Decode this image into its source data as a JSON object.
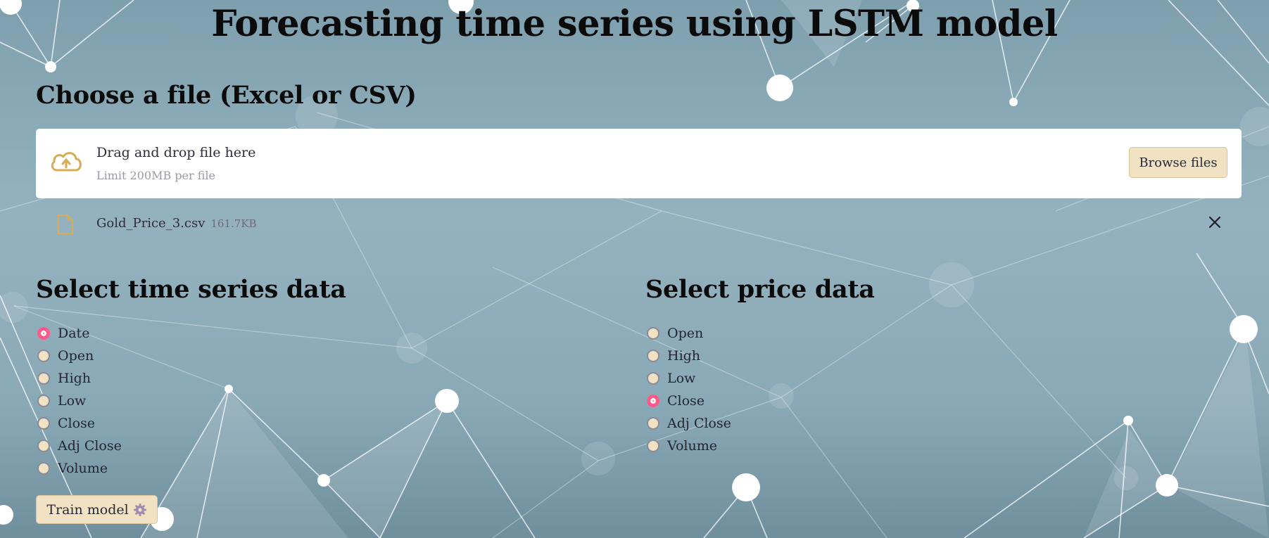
{
  "page": {
    "title": "Forecasting time series using LSTM model"
  },
  "uploader": {
    "heading": "Choose a file (Excel or CSV)",
    "drop_text": "Drag and drop file here",
    "limit_text": "Limit 200MB per file",
    "browse_label": "Browse files",
    "file": {
      "name": "Gold_Price_3.csv",
      "size": "161.7KB"
    }
  },
  "time_series": {
    "heading": "Select time series data",
    "options": [
      "Date",
      "Open",
      "High",
      "Low",
      "Close",
      "Adj Close",
      "Volume"
    ],
    "selected": "Date"
  },
  "price": {
    "heading": "Select price data",
    "options": [
      "Open",
      "High",
      "Low",
      "Close",
      "Adj Close",
      "Volume"
    ],
    "selected": "Close"
  },
  "train_button": {
    "label": "Train model",
    "icon": "gear-icon"
  },
  "colors": {
    "accent": "#ff5a8a",
    "button_bg": "#f2e2c4",
    "icon_gold": "#d6ad55",
    "background": "#8aa9b6"
  }
}
